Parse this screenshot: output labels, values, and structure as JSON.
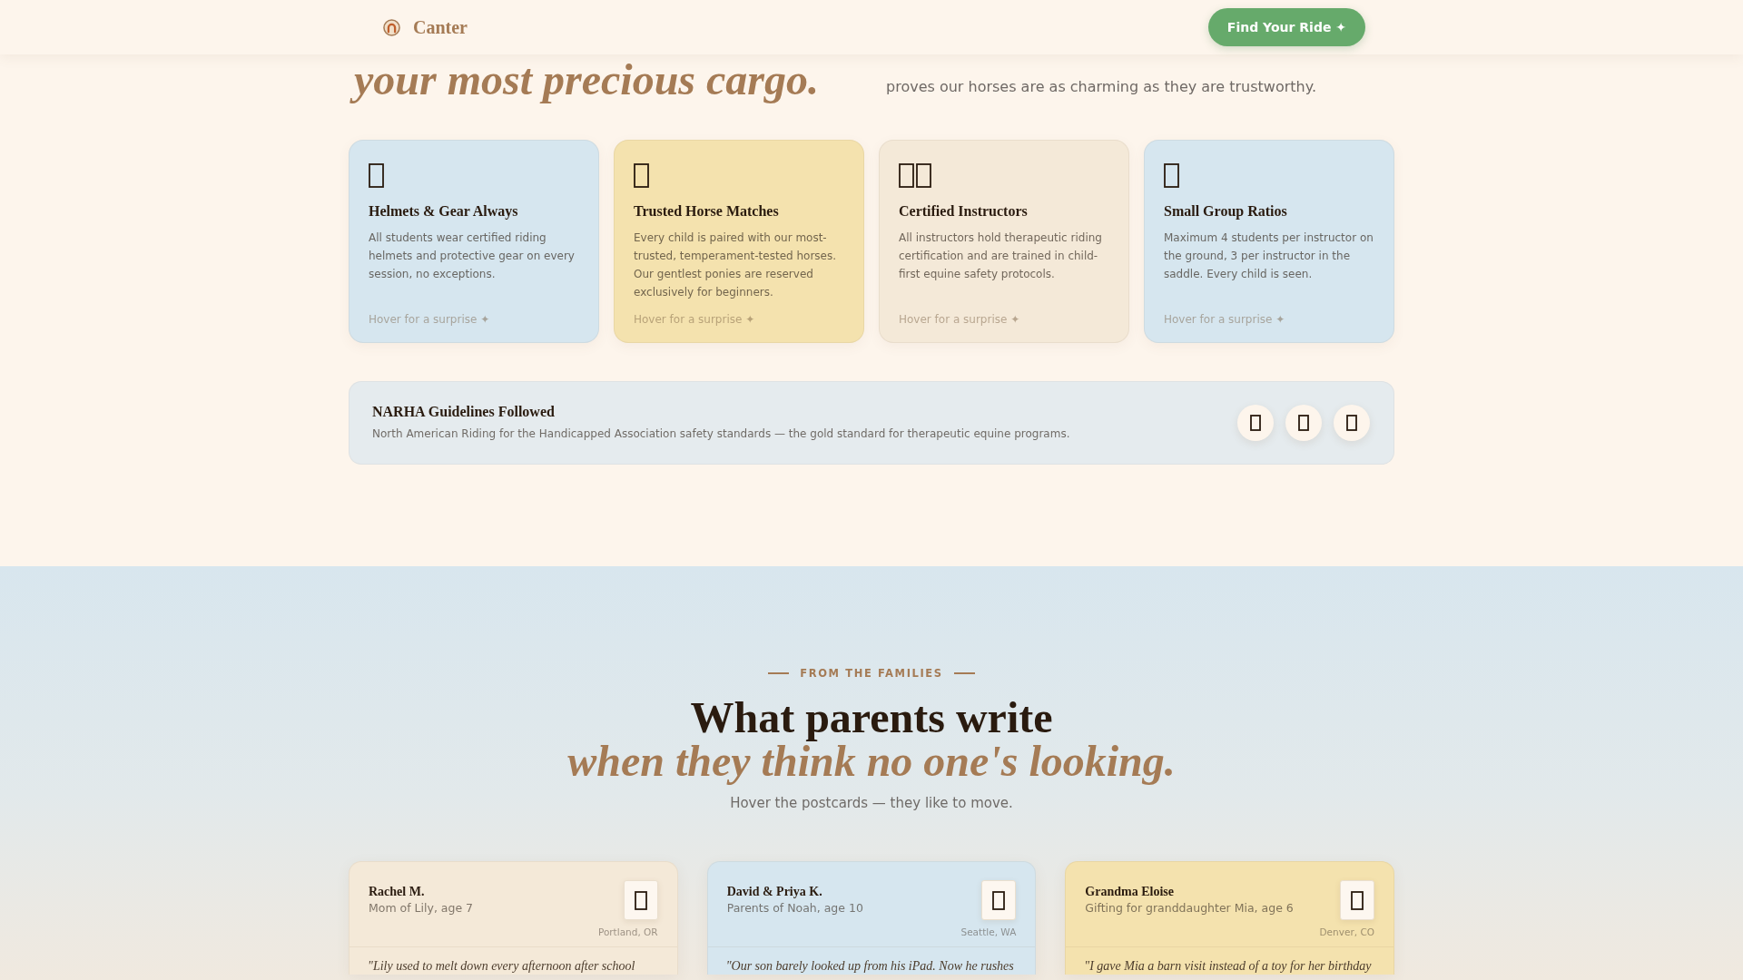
{
  "header": {
    "brand": "Canter",
    "cta": "Find Your Ride ✦"
  },
  "hero": {
    "headline": "your most precious cargo.",
    "text": "proves our horses are as charming as they are trustworthy."
  },
  "features": [
    {
      "kind": "single",
      "title": "Helmets & Gear Always",
      "description": "All students wear certified riding helmets and protective gear on every session, no exceptions.",
      "hint": "Hover for a surprise ✦",
      "color": "#d6e6ef"
    },
    {
      "kind": "single",
      "title": "Trusted Horse Matches",
      "description": "Every child is paired with our most-trusted, temperament-tested horses. Our gentlest ponies are reserved exclusively for beginners.",
      "hint": "Hover for a surprise ✦",
      "color": "#f4e2ae"
    },
    {
      "kind": "pair",
      "title": "Certified Instructors",
      "description": "All instructors hold therapeutic riding certification and are trained in child-first equine safety protocols.",
      "hint": "Hover for a surprise ✦",
      "color": "#f4e9d8"
    },
    {
      "kind": "single",
      "title": "Small Group Ratios",
      "description": "Maximum 4 students per instructor on the ground, 3 per instructor in the saddle. Every child is seen.",
      "hint": "Hover for a surprise ✦",
      "color": "#d6e6ef"
    }
  ],
  "guidelines": {
    "title": "NARHA Guidelines Followed",
    "description": "North American Riding for the Handicapped Association safety standards — the gold standard for therapeutic equine programs."
  },
  "testimonials": {
    "eyebrow": "FROM THE FAMILIES",
    "title": "What parents write",
    "title_accent": "when they think no one's looking.",
    "subtitle": "Hover the postcards — they like to move.",
    "postcards": [
      {
        "name": "Rachel M.",
        "relation": "Mom of Lily, age 7",
        "location": "Portland, OR",
        "quote": "\"Lily used to melt down every afternoon after school",
        "color": "#f4e9d8"
      },
      {
        "name": "David & Priya K.",
        "relation": "Parents of Noah, age 10",
        "location": "Seattle, WA",
        "quote": "\"Our son barely looked up from his iPad. Now he rushes",
        "color": "#d6e6ef"
      },
      {
        "name": "Grandma Eloise",
        "relation": "Gifting for granddaughter Mia, age 6",
        "location": "Denver, CO",
        "quote": "\"I gave Mia a barn visit instead of a toy for her birthday",
        "color": "#f4e2ae"
      }
    ]
  }
}
